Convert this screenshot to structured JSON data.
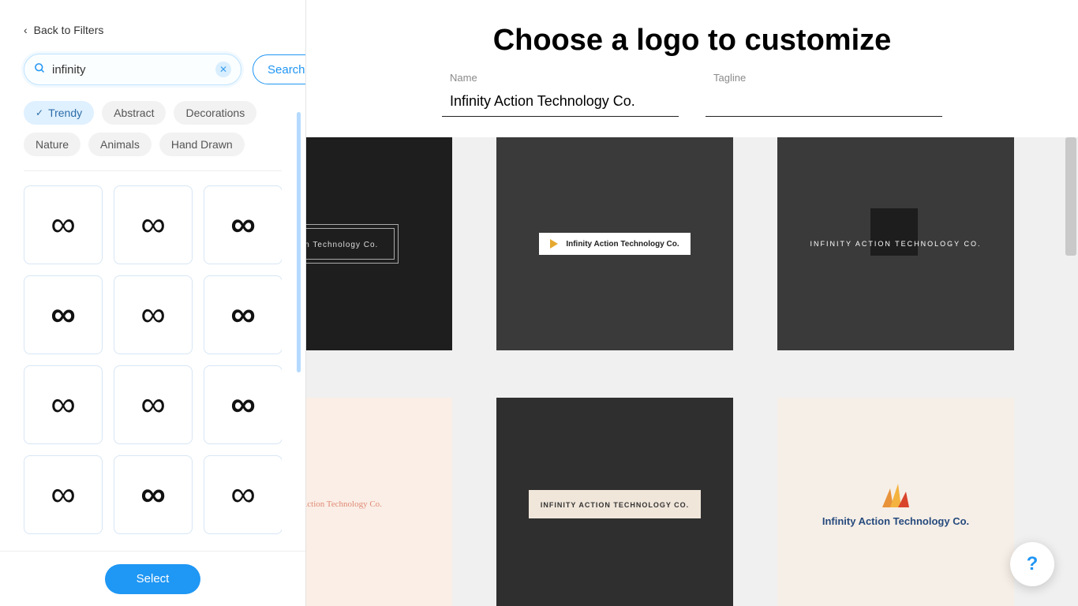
{
  "sidebar": {
    "back": "Back to Filters",
    "search_value": "infinity",
    "search_button": "Search",
    "select_button": "Select",
    "chips": [
      "Trendy",
      "Abstract",
      "Decorations",
      "Nature",
      "Animals",
      "Hand Drawn"
    ],
    "active_chip_index": 0,
    "icons": [
      "∞",
      "∞",
      "∞",
      "∞",
      "∞",
      "∞",
      "∞",
      "∞",
      "∞",
      "∞",
      "∞",
      "∞"
    ]
  },
  "main": {
    "title": "Choose a logo to customize",
    "name_label": "Name",
    "name_value": "Infinity Action Technology Co.",
    "tagline_label": "Tagline",
    "tagline_value": "",
    "cards": {
      "r1c1": "ction Technology Co.",
      "r1c2": "Infinity Action Technology Co.",
      "r1c3": "INFINITY ACTION TECHNOLOGY CO.",
      "r2c1": "nity Action Technology Co.",
      "r2c2": "INFINITY ACTION TECHNOLOGY CO.",
      "r2c3": "Infinity Action Technology Co."
    }
  },
  "help": "?"
}
